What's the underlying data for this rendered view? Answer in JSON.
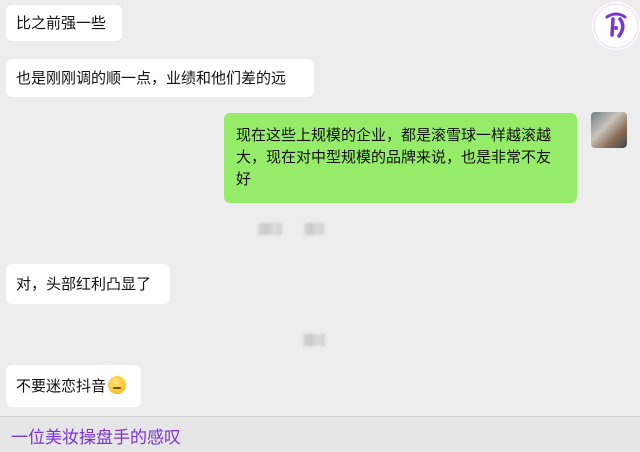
{
  "messages": [
    {
      "side": "left",
      "text": "比之前强一些"
    },
    {
      "side": "left",
      "text": "也是刚刚调的顺一点，业绩和他们差的远"
    },
    {
      "side": "right",
      "text": "现在这些上规模的企业，都是滚雪球一样越滚越大，现在对中型规模的品牌来说，也是非常不友好"
    },
    {
      "side": "left",
      "text": "对，头部红利凸显了"
    },
    {
      "side": "left",
      "text": "不要迷恋抖音",
      "emoji": "thinking-face"
    }
  ],
  "caption": "一位美妆操盘手的感叹",
  "colors": {
    "left_bubble": "#ffffff",
    "right_bubble": "#95ec69",
    "background": "#ededed",
    "caption_text": "#7b35d6"
  }
}
